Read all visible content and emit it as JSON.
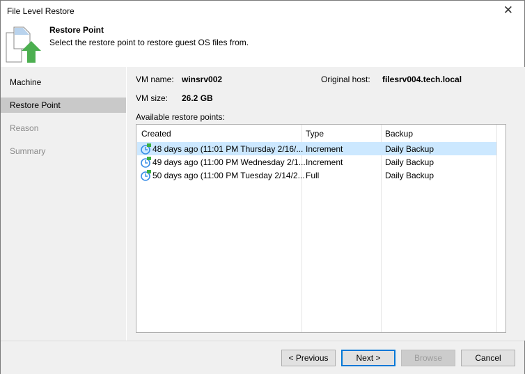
{
  "window": {
    "title": "File Level Restore"
  },
  "header": {
    "title": "Restore Point",
    "description": "Select the restore point to restore guest OS files from."
  },
  "sidebar": {
    "items": [
      {
        "label": "Machine"
      },
      {
        "label": "Restore Point"
      },
      {
        "label": "Reason"
      },
      {
        "label": "Summary"
      }
    ]
  },
  "vm": {
    "name_label": "VM name:",
    "name": "winsrv002",
    "size_label": "VM size:",
    "size": "26.2 GB",
    "host_label": "Original host:",
    "host": "filesrv004.tech.local"
  },
  "list": {
    "label": "Available restore points:",
    "columns": [
      "Created",
      "Type",
      "Backup"
    ],
    "rows": [
      {
        "created": "48 days ago (11:01 PM Thursday 2/16/...",
        "type": "Increment",
        "backup": "Daily Backup"
      },
      {
        "created": "49 days ago (11:00 PM Wednesday 2/1...",
        "type": "Increment",
        "backup": "Daily Backup"
      },
      {
        "created": "50 days ago (11:00 PM Tuesday 2/14/2...",
        "type": "Full",
        "backup": "Daily Backup"
      }
    ]
  },
  "buttons": {
    "previous": "< Previous",
    "next": "Next >",
    "browse": "Browse",
    "cancel": "Cancel"
  }
}
